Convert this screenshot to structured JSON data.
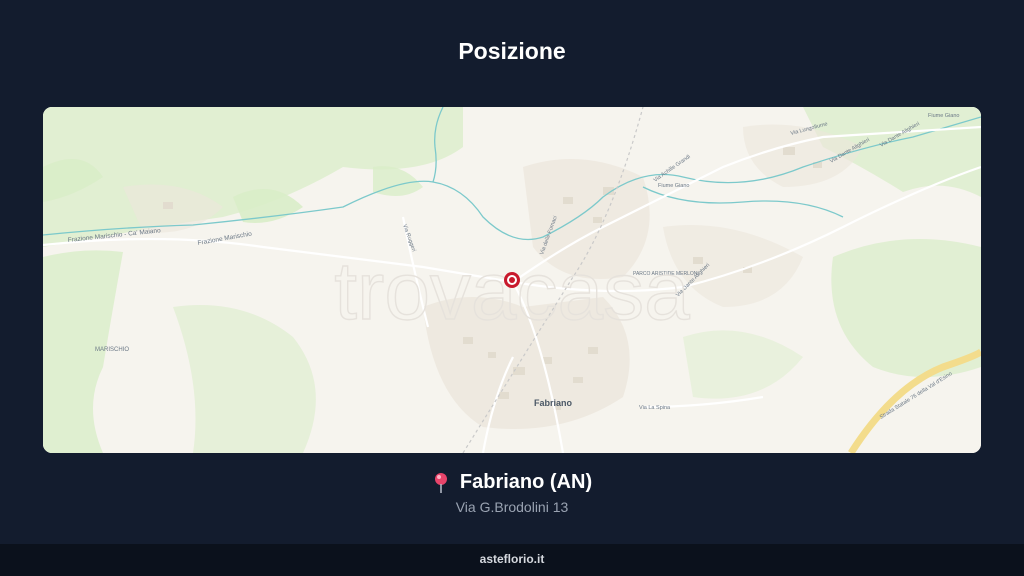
{
  "header": {
    "title": "Posizione"
  },
  "map": {
    "watermark": "trovacasa",
    "labels": {
      "fabriano": "Fabriano",
      "marischio": "MARISCHIO",
      "frazione_ca_maiano": "Frazione Marischio - Ca' Maiano",
      "frazione_marischio": "Frazione Marischio",
      "via_della_ferrovia": "Via delle Fornaci",
      "via_achille_grandi": "Via Achille Grandi",
      "via_dante_alighieri_1": "Via Dante Alighieri",
      "via_dante_alighieri_2": "Via Dante Alighieri",
      "via_dante_alighieri_3": "Via Dante Alighieri",
      "via_lungofiume": "Via Lungofiume",
      "via_la_spina": "Via La Spina",
      "parco": "PARCO ARISTIDE MERLONI",
      "strada_statale": "Strada Statale 76 della Val d'Esino",
      "via_ruggeri": "Via Ruggeri",
      "fiume_giano_1": "Fiume Giano",
      "fiume_giano_2": "Fiume Giano"
    },
    "colors": {
      "marker": "#c8192c",
      "green": "#d6ecc4",
      "river": "#6fc6c9",
      "highway": "#f3dc8c"
    }
  },
  "location": {
    "pin_icon": "map-pin-icon",
    "name": "Fabriano (AN)",
    "address": "Via G.Brodolini 13"
  },
  "footer": {
    "site": "asteflorio.it"
  }
}
